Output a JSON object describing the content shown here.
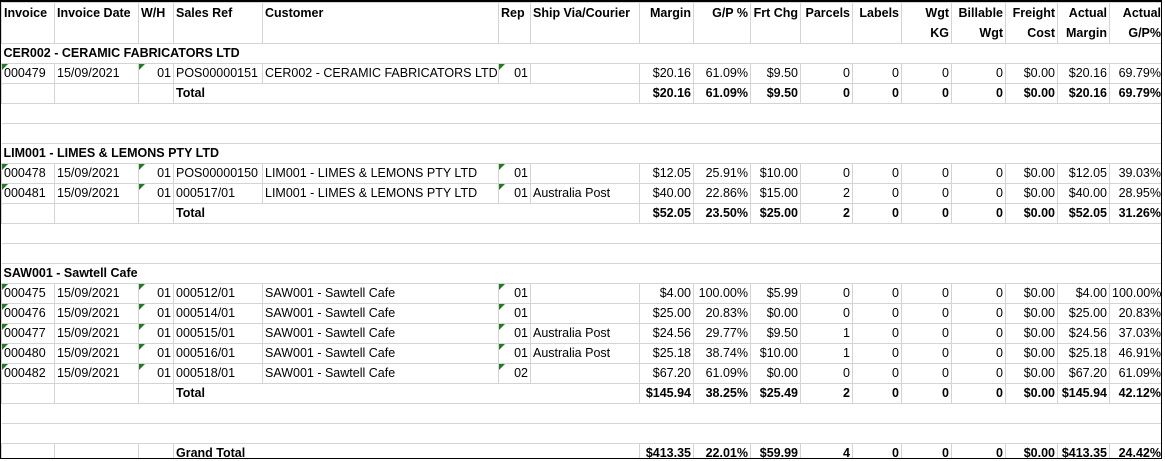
{
  "columns": [
    "Invoice",
    "Invoice Date",
    "W/H",
    "Sales Ref",
    "Customer",
    "Rep",
    "Ship Via/Courier",
    "Margin",
    "G/P %",
    "Frt Chg",
    "Parcels",
    "Labels",
    "Wgt KG",
    "Billable Wgt",
    "Freight Cost",
    "Actual Margin",
    "Actual G/P%"
  ],
  "total_label": "Total",
  "groups": [
    {
      "title": "CER002 - CERAMIC FABRICATORS LTD",
      "rows": [
        [
          "000479",
          "15/09/2021",
          "01",
          "POS00000151",
          "CER002 - CERAMIC FABRICATORS LTD",
          "01",
          "",
          "$20.16",
          "61.09%",
          "$9.50",
          "0",
          "0",
          "0",
          "0",
          "$0.00",
          "$20.16",
          "69.79%"
        ]
      ],
      "total": [
        "$20.16",
        "61.09%",
        "$9.50",
        "0",
        "0",
        "0",
        "0",
        "$0.00",
        "$20.16",
        "69.79%"
      ]
    },
    {
      "title": "LIM001 - LIMES & LEMONS PTY LTD",
      "rows": [
        [
          "000478",
          "15/09/2021",
          "01",
          "POS00000150",
          "LIM001 - LIMES & LEMONS PTY LTD",
          "01",
          "",
          "$12.05",
          "25.91%",
          "$10.00",
          "0",
          "0",
          "0",
          "0",
          "$0.00",
          "$12.05",
          "39.03%"
        ],
        [
          "000481",
          "15/09/2021",
          "01",
          "000517/01",
          "LIM001 - LIMES & LEMONS PTY LTD",
          "01",
          "Australia Post",
          "$40.00",
          "22.86%",
          "$15.00",
          "2",
          "0",
          "0",
          "0",
          "$0.00",
          "$40.00",
          "28.95%"
        ]
      ],
      "total": [
        "$52.05",
        "23.50%",
        "$25.00",
        "2",
        "0",
        "0",
        "0",
        "$0.00",
        "$52.05",
        "31.26%"
      ]
    },
    {
      "title": "SAW001 - Sawtell Cafe",
      "rows": [
        [
          "000475",
          "15/09/2021",
          "01",
          "000512/01",
          "SAW001 - Sawtell Cafe",
          "01",
          "",
          "$4.00",
          "100.00%",
          "$5.99",
          "0",
          "0",
          "0",
          "0",
          "$0.00",
          "$4.00",
          "100.00%"
        ],
        [
          "000476",
          "15/09/2021",
          "01",
          "000514/01",
          "SAW001 - Sawtell Cafe",
          "01",
          "",
          "$25.00",
          "20.83%",
          "$0.00",
          "0",
          "0",
          "0",
          "0",
          "$0.00",
          "$25.00",
          "20.83%"
        ],
        [
          "000477",
          "15/09/2021",
          "01",
          "000515/01",
          "SAW001 - Sawtell Cafe",
          "01",
          "Australia Post",
          "$24.56",
          "29.77%",
          "$9.50",
          "1",
          "0",
          "0",
          "0",
          "$0.00",
          "$24.56",
          "37.03%"
        ],
        [
          "000480",
          "15/09/2021",
          "01",
          "000516/01",
          "SAW001 - Sawtell Cafe",
          "01",
          "Australia Post",
          "$25.18",
          "38.74%",
          "$10.00",
          "1",
          "0",
          "0",
          "0",
          "$0.00",
          "$25.18",
          "46.91%"
        ],
        [
          "000482",
          "15/09/2021",
          "01",
          "000518/01",
          "SAW001 - Sawtell Cafe",
          "02",
          "",
          "$67.20",
          "61.09%",
          "$0.00",
          "0",
          "0",
          "0",
          "0",
          "$0.00",
          "$67.20",
          "61.09%"
        ]
      ],
      "total": [
        "$145.94",
        "38.25%",
        "$25.49",
        "2",
        "0",
        "0",
        "0",
        "$0.00",
        "$145.94",
        "42.12%"
      ]
    }
  ],
  "grand_total": {
    "label": "Grand Total",
    "values": [
      "$413.35",
      "22.01%",
      "$59.99",
      "4",
      "0",
      "0",
      "0",
      "$0.00",
      "$413.35",
      "24.42%"
    ]
  },
  "colors": {
    "error_indicator": "#1e7b1e",
    "gridline": "#d4d4d4"
  }
}
